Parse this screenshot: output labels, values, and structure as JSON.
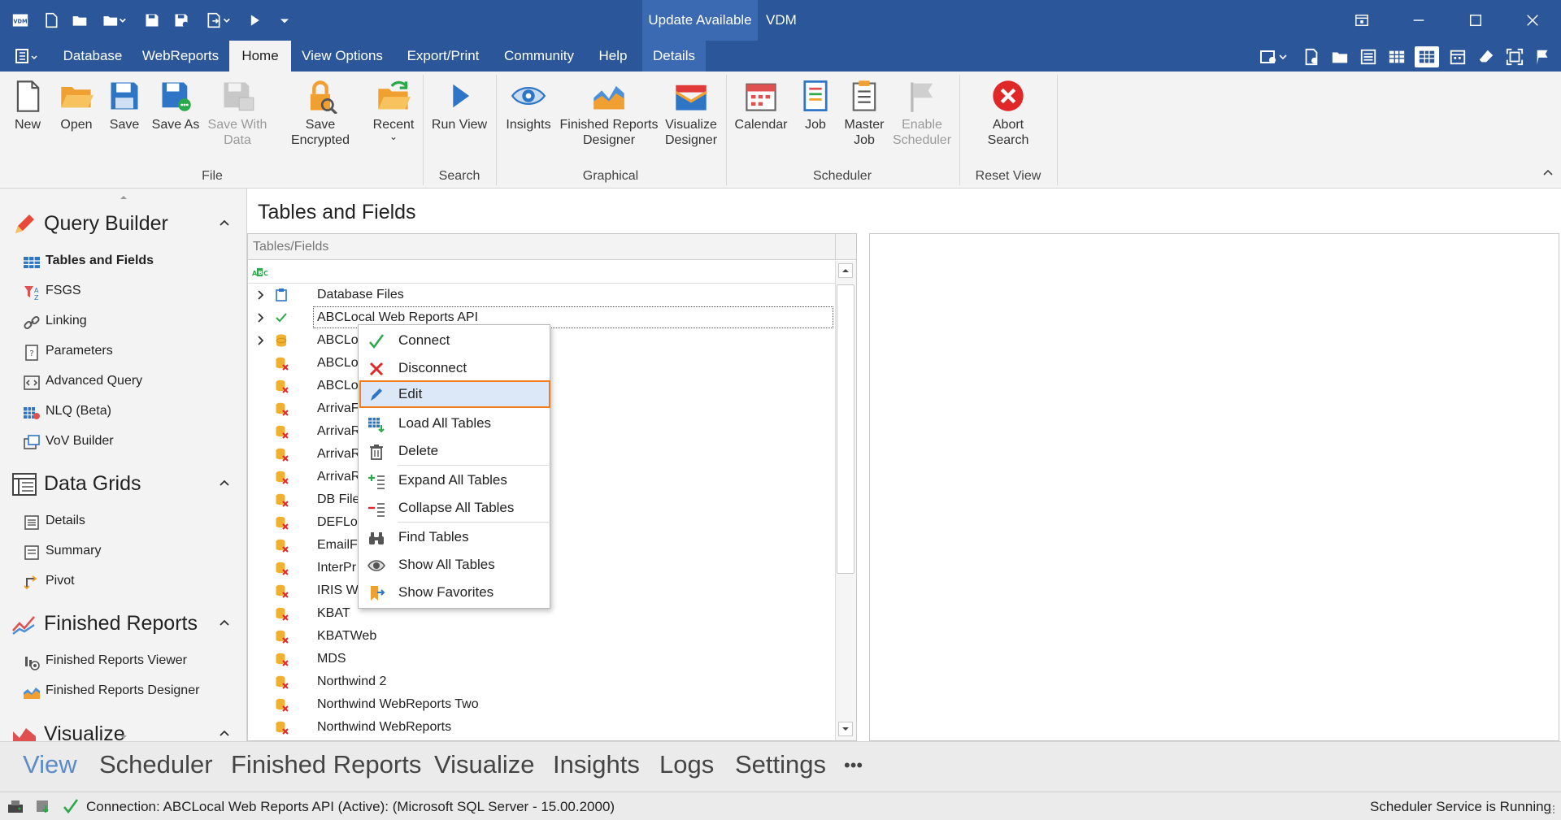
{
  "window": {
    "update_label": "Update Available",
    "app_name": "VDM"
  },
  "menubar": {
    "tabs": [
      "Database",
      "WebReports",
      "Home",
      "View Options",
      "Export/Print",
      "Community",
      "Help",
      "Details"
    ],
    "active_tab": "Home"
  },
  "ribbon": {
    "file": {
      "new": "New",
      "open": "Open",
      "save": "Save",
      "save_as": "Save As",
      "save_with_data_1": "Save With",
      "save_with_data_2": "Data",
      "save_encrypted": "Save Encrypted",
      "recent": "Recent",
      "group": "File"
    },
    "search": {
      "run_view": "Run View",
      "group": "Search"
    },
    "graphical": {
      "insights": "Insights",
      "finished_1": "Finished Reports",
      "finished_2": "Designer",
      "visualize_1": "Visualize",
      "visualize_2": "Designer",
      "group": "Graphical"
    },
    "scheduler": {
      "calendar": "Calendar",
      "job": "Job",
      "master_1": "Master",
      "master_2": "Job",
      "enable_1": "Enable",
      "enable_2": "Scheduler",
      "group": "Scheduler"
    },
    "reset": {
      "abort_1": "Abort",
      "abort_2": "Search",
      "group": "Reset View"
    }
  },
  "leftnav": {
    "query_builder": {
      "title": "Query Builder",
      "items": [
        "Tables and Fields",
        "FSGS",
        "Linking",
        "Parameters",
        "Advanced Query",
        "NLQ (Beta)",
        "VoV Builder"
      ]
    },
    "data_grids": {
      "title": "Data Grids",
      "items": [
        "Details",
        "Summary",
        "Pivot"
      ]
    },
    "finished_reports": {
      "title": "Finished Reports",
      "items": [
        "Finished Reports Viewer",
        "Finished Reports Designer"
      ]
    },
    "visualize": {
      "title": "Visualize"
    }
  },
  "main": {
    "title": "Tables and Fields",
    "tree_header": "Tables/Fields",
    "rows": [
      "Database Files",
      "ABCLocal Web Reports API",
      "ABCLoc",
      "ABCLoc",
      "ABCLoc",
      "ArrivaF",
      "ArrivaR",
      "ArrivaR",
      "ArrivaR",
      "DB File",
      "DEFLoc",
      "EmailFi",
      "InterPr",
      "IRIS W",
      "KBAT",
      "KBATWeb",
      "MDS",
      "Northwind 2",
      "Northwind WebReports Two",
      "Northwind WebReports"
    ]
  },
  "context_menu": {
    "items": [
      "Connect",
      "Disconnect",
      "Edit",
      "Load All Tables",
      "Delete",
      "Expand All Tables",
      "Collapse All Tables",
      "Find Tables",
      "Show All Tables",
      "Show Favorites"
    ],
    "highlighted": "Edit"
  },
  "bottom_tabs": {
    "items": [
      "View",
      "Scheduler",
      "Finished Reports",
      "Visualize",
      "Insights",
      "Logs",
      "Settings",
      "•••"
    ],
    "active": "View"
  },
  "status": {
    "connection": "Connection: ABCLocal Web Reports API (Active): (Microsoft SQL Server - 15.00.2000)",
    "scheduler": "Scheduler Service is Running"
  }
}
